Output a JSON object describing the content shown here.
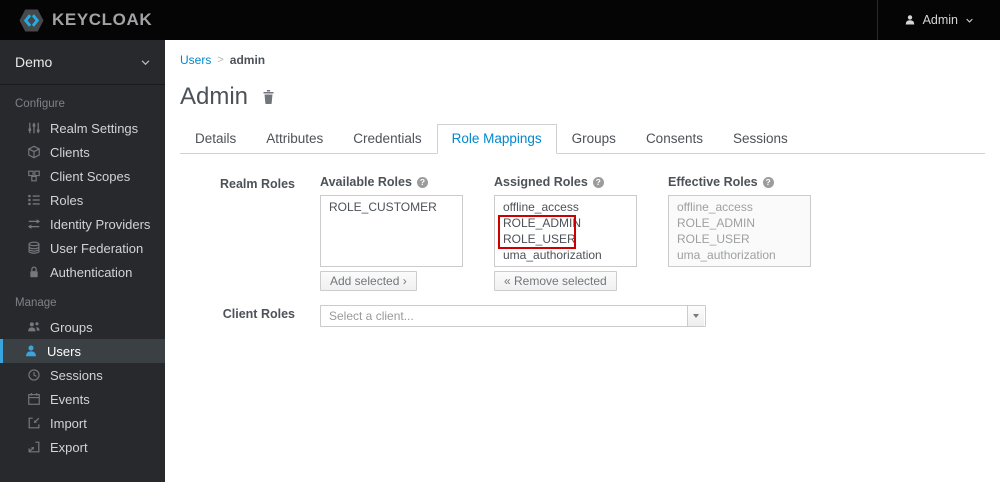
{
  "header": {
    "brand": "KEYCLOAK",
    "user": {
      "label": "Admin",
      "icon": "user-icon",
      "caret_icon": "chevron-down-icon"
    },
    "logo_icon": "keycloak-logo",
    "colors": {
      "bg": "#050505",
      "brand_text": "#a3a3a6",
      "logo_badge": "#47484a",
      "logo_chevrons": "#29abe2"
    }
  },
  "sidebar": {
    "realm_selector": {
      "label": "Demo",
      "icon": "chevron-down-icon"
    },
    "sections": [
      {
        "label": "Configure",
        "items": [
          {
            "label": "Realm Settings",
            "icon": "sliders-icon",
            "active": false
          },
          {
            "label": "Clients",
            "icon": "cube-icon",
            "active": false
          },
          {
            "label": "Client Scopes",
            "icon": "cubes-icon",
            "active": false
          },
          {
            "label": "Roles",
            "icon": "list-icon",
            "active": false
          },
          {
            "label": "Identity Providers",
            "icon": "exchange-icon",
            "active": false
          },
          {
            "label": "User Federation",
            "icon": "database-icon",
            "active": false
          },
          {
            "label": "Authentication",
            "icon": "lock-icon",
            "active": false
          }
        ]
      },
      {
        "label": "Manage",
        "items": [
          {
            "label": "Groups",
            "icon": "users-icon",
            "active": false
          },
          {
            "label": "Users",
            "icon": "user-icon",
            "active": true
          },
          {
            "label": "Sessions",
            "icon": "clock-icon",
            "active": false
          },
          {
            "label": "Events",
            "icon": "calendar-icon",
            "active": false
          },
          {
            "label": "Import",
            "icon": "import-icon",
            "active": false
          },
          {
            "label": "Export",
            "icon": "export-icon",
            "active": false
          }
        ]
      }
    ],
    "colors": {
      "bg": "#28292d",
      "active_border": "#39a5dc",
      "active_bg": "#3b4045"
    }
  },
  "breadcrumb": {
    "parent": "Users",
    "separator": ">",
    "current": "admin"
  },
  "page": {
    "title": "Admin",
    "delete_icon": "trash-icon"
  },
  "tabs": {
    "items": [
      "Details",
      "Attributes",
      "Credentials",
      "Role Mappings",
      "Groups",
      "Consents",
      "Sessions"
    ],
    "active": "Role Mappings",
    "active_color": "#0088ce"
  },
  "realm_roles": {
    "row_label": "Realm Roles",
    "available": {
      "label": "Available Roles",
      "help_icon": "question-circle-icon",
      "options": [
        "ROLE_CUSTOMER"
      ],
      "action": "Add selected ›"
    },
    "assigned": {
      "label": "Assigned Roles",
      "help_icon": "question-circle-icon",
      "options": [
        "offline_access",
        "ROLE_ADMIN",
        "ROLE_USER",
        "uma_authorization"
      ],
      "action": "« Remove selected",
      "highlighted_options": [
        "ROLE_ADMIN",
        "ROLE_USER"
      ],
      "highlight_color": "#cc0000"
    },
    "effective": {
      "label": "Effective Roles",
      "help_icon": "question-circle-icon",
      "options": [
        "offline_access",
        "ROLE_ADMIN",
        "ROLE_USER",
        "uma_authorization"
      ],
      "disabled": true
    }
  },
  "client_roles": {
    "row_label": "Client Roles",
    "placeholder": "Select a client...",
    "caret_icon": "caret-down-icon"
  },
  "icons": {
    "help_glyph": "?"
  }
}
